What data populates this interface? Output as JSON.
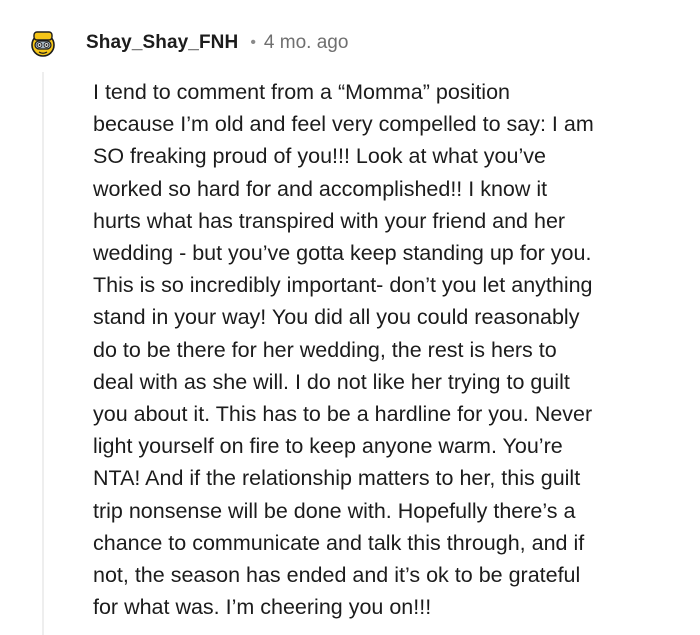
{
  "comment": {
    "username": "Shay_Shay_FNH",
    "separator": "•",
    "timestamp": "4 mo. ago",
    "avatar_icon": "snoo-avatar-icon",
    "body_lines": [
      "I tend to comment from a “Momma” position",
      "because I’m old and feel very compelled to say: I am",
      "SO freaking proud of you!!! Look at what you’ve",
      "worked so hard for and accomplished!! I know it",
      "hurts what has transpired with your friend and her",
      "wedding - but you’ve gotta keep standing up for you.",
      "This is so incredibly important- don’t you let anything",
      "stand in your way! You did all you could reasonably",
      "do to be there for her wedding, the rest is hers to",
      "deal with as she will. I do not like her trying to guilt",
      "you about it. This has to be a hardline for you. Never",
      "light yourself on fire to keep anyone warm. You’re",
      "NTA! And if the relationship matters to her, this guilt",
      "trip nonsense will be done with. Hopefully there’s a",
      "chance to communicate and talk this through, and if",
      "not, the season has ended and it’s ok to be grateful",
      "for what was. I’m cheering you on!!!"
    ]
  }
}
